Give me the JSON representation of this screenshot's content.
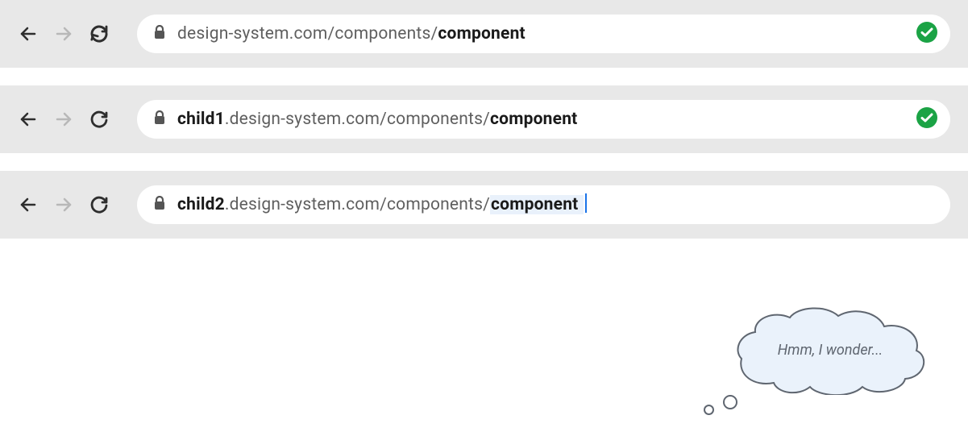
{
  "bars": [
    {
      "subdomain": "",
      "domain": "design-system.com",
      "path": "/components/",
      "slug": "component",
      "status": "ok",
      "editing": false
    },
    {
      "subdomain": "child1",
      "domain": ".design-system.com",
      "path": "/components/",
      "slug": "component",
      "status": "ok",
      "editing": false
    },
    {
      "subdomain": "child2",
      "domain": ".design-system.com",
      "path": "/components/",
      "slug": "component",
      "status": "",
      "editing": true
    }
  ],
  "thought": {
    "text": "Hmm, I wonder..."
  }
}
